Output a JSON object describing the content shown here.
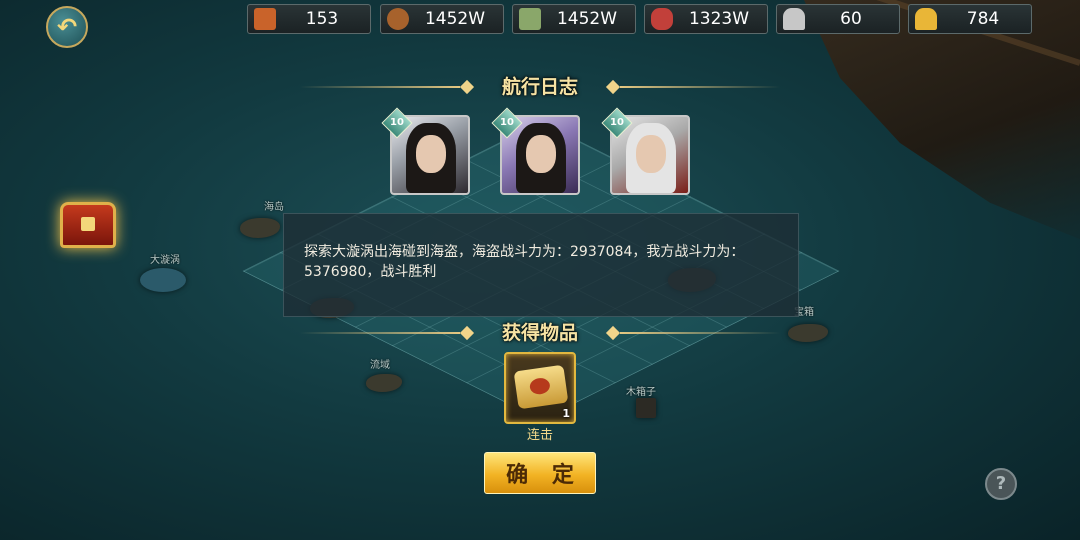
{
  "resources": [
    {
      "name": "令牌",
      "icon": "token-icon",
      "value": "153",
      "color": "#c9632a"
    },
    {
      "name": "木材",
      "icon": "wood-icon",
      "value": "1452W",
      "color": "#a7622c"
    },
    {
      "name": "粮草",
      "icon": "food-icon",
      "value": "1452W",
      "color": "#8aa76a"
    },
    {
      "name": "肉",
      "icon": "meat-icon",
      "value": "1323W",
      "color": "#c2403a"
    },
    {
      "name": "银两",
      "icon": "silver-icon",
      "value": "60",
      "color": "#c7c7c7"
    },
    {
      "name": "元宝",
      "icon": "gold-icon",
      "value": "784",
      "color": "#e9b637"
    }
  ],
  "map_labels": [
    "海岛",
    "大漩涡",
    "流域",
    "木箱子",
    "宝箱"
  ],
  "log": {
    "title": "航行日志",
    "hero_levels": [
      "10",
      "10",
      "10"
    ],
    "message": "探索大漩涡出海碰到海盗，海盗战斗力为：2937084，我方战斗力为：5376980，战斗胜利"
  },
  "reward": {
    "title": "获得物品",
    "item_name": "连击",
    "item_count": "1"
  },
  "confirm_label": "确 定",
  "help_label": "?",
  "back_label": "↶"
}
